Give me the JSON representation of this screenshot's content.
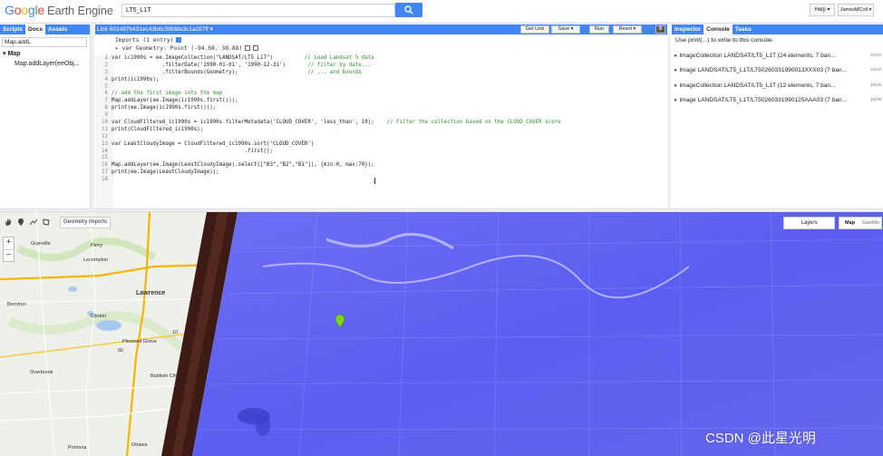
{
  "header": {
    "logo_google": [
      "G",
      "o",
      "o",
      "g",
      "l",
      "e"
    ],
    "logo_product": "Earth Engine",
    "search_value": "LT5_L1T",
    "help_label": "Help ▾",
    "user_label": "JamesMColl ▾"
  },
  "left_panel": {
    "tabs": [
      "Scripts",
      "Docs",
      "Assets"
    ],
    "active_tab": "Docs",
    "search_value": "Map.addL",
    "tree_group": "▾ Map",
    "tree_item": "Map.addLayer(eeObj..."
  },
  "editor": {
    "title": "Link 601497b431ec43b6c59fd8e3c1a287ff ▾",
    "buttons": {
      "get_link": "Get Link",
      "save": "Save ▾",
      "run": "Run",
      "reset": "Reset ▾"
    },
    "imports_header": "Imports (1 entry)",
    "imports_entry": "▸ var Geometry: Point (-94.68, 38.88)",
    "lines": [
      {
        "n": "1",
        "t": "var ic1990s = ee.ImageCollection(\"LANDSAT/LT5_L1T\")          // Load Landsat 5 data"
      },
      {
        "n": "2",
        "t": "                .filterDate('1990-01-01', '1990-12-31')       // filter by date..."
      },
      {
        "n": "3",
        "t": "                .filterBounds(Geometry);                      // ... and bounds"
      },
      {
        "n": "4",
        "t": "print(ic1990s);"
      },
      {
        "n": "5",
        "t": ""
      },
      {
        "n": "6",
        "t": "// add the first image into the map"
      },
      {
        "n": "7",
        "t": "Map.addLayer(ee.Image(ic1990s.first()));"
      },
      {
        "n": "8",
        "t": "print(ee.Image(ic1990s.first()));"
      },
      {
        "n": "9",
        "t": ""
      },
      {
        "n": "10",
        "t": "var CloudFiltered_ic1990s = ic1990s.filterMetadata('CLOUD_COVER', 'less_than', 10);    // Filter the collection based on the CLOUD_COVER score"
      },
      {
        "n": "11",
        "t": "print(CloudFiltered_ic1990s);"
      },
      {
        "n": "12",
        "t": ""
      },
      {
        "n": "13",
        "t": "var LeastCloudyImage = CloudFiltered_ic1990s.sort('CLOUD_COVER')"
      },
      {
        "n": "14",
        "t": "                                          .first();"
      },
      {
        "n": "15",
        "t": ""
      },
      {
        "n": "16",
        "t": "Map.addLayer(ee.Image(LeastCloudyImage).select([\"B3\",\"B2\",\"B1\"]), {min:0, max:70});"
      },
      {
        "n": "17",
        "t": "print(ee.Image(LeastCloudyImage));"
      },
      {
        "n": "18",
        "t": ""
      }
    ]
  },
  "right_panel": {
    "tabs": [
      "Inspector",
      "Console",
      "Tasks"
    ],
    "active_tab": "Console",
    "hint": "Use print(...) to write to this console.",
    "entries": [
      "ImageCollection LANDSAT/LT5_L1T (24 elements, 7 ban...",
      "Image LANDSAT/LT5_L1T/LT50260331990013XXX03 (7 ban...",
      "ImageCollection LANDSAT/LT5_L1T (12 elements, 7 ban...",
      "Image LANDSAT/LT5_L1T/LT50260331990125AAA03 (7 ban..."
    ],
    "json_label": "JSON"
  },
  "map": {
    "geometry_imports": "Geometry Imports",
    "zoom_in": "+",
    "zoom_out": "−",
    "layers": "Layers",
    "map_type": "Map",
    "satellite_type": "Satellite",
    "places": {
      "granville": "Granville",
      "perry": "Perry",
      "lecompton": "Lecompton",
      "lawrence": "Lawrence",
      "berryton": "Berryton",
      "clinton": "Clinton",
      "pleasant_grove": "Pleasant Grove",
      "overbrook": "Overbrook",
      "baldwin_city": "Baldwin City",
      "pomona": "Pomona",
      "ottawa": "Ottawa",
      "place_56": "56",
      "place_10": "10"
    },
    "watermark": "CSDN @此星光明",
    "colors": {
      "imagery": "#5b5ef0",
      "edge": "#3e1a14",
      "roads": "#f5b400"
    }
  }
}
